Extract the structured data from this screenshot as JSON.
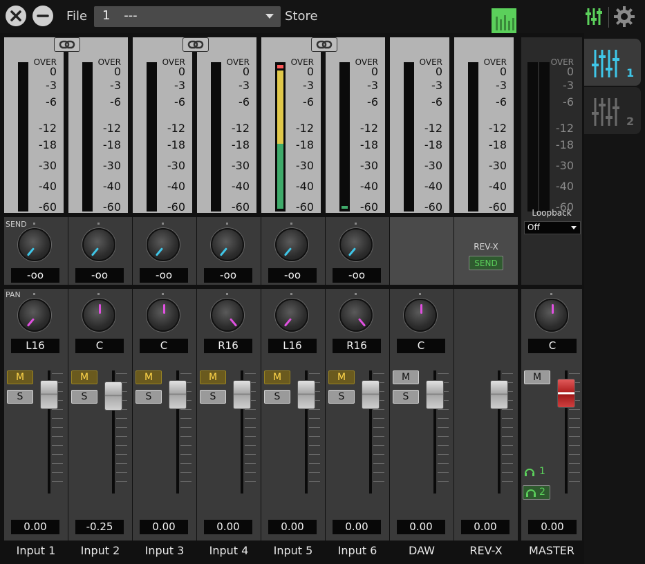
{
  "topbar": {
    "file_label": "File",
    "file_number": "1",
    "file_name": "---",
    "store_label": "Store"
  },
  "colors": {
    "accent_cyan": "#3fc6e8",
    "pan_magenta": "#e050e0",
    "send_green": "#5bd05b",
    "mute_yellow": "#ffd54a",
    "master_red": "#c02a2a"
  },
  "icons": [
    "close-icon",
    "minimize-icon",
    "chevron-down-icon",
    "meter-icon",
    "mixer-icon",
    "gear-icon",
    "link-icon",
    "headphones-icon"
  ],
  "meter_scale": [
    "OVER",
    "0",
    "-3",
    "-6",
    "-12",
    "-18",
    "-30",
    "-40",
    "-60"
  ],
  "section_labels": {
    "send": "SEND",
    "pan": "PAN"
  },
  "strips": [
    {
      "name": "Input 1",
      "send_value": "-oo",
      "pan_value": "L16",
      "fader_value": "0.00",
      "mute_label": "M",
      "solo_label": "S"
    },
    {
      "name": "Input 2",
      "send_value": "-oo",
      "pan_value": "C",
      "fader_value": "-0.25",
      "mute_label": "M",
      "solo_label": "S"
    },
    {
      "name": "Input 3",
      "send_value": "-oo",
      "pan_value": "C",
      "fader_value": "0.00",
      "mute_label": "M",
      "solo_label": "S"
    },
    {
      "name": "Input 4",
      "send_value": "-oo",
      "pan_value": "R16",
      "fader_value": "0.00",
      "mute_label": "M",
      "solo_label": "S"
    },
    {
      "name": "Input 5",
      "send_value": "-oo",
      "pan_value": "L16",
      "fader_value": "0.00",
      "mute_label": "M",
      "solo_label": "S"
    },
    {
      "name": "Input 6",
      "send_value": "-oo",
      "pan_value": "R16",
      "fader_value": "0.00",
      "mute_label": "M",
      "solo_label": "S"
    },
    {
      "name": "DAW",
      "pan_value": "C",
      "fader_value": "0.00",
      "mute_label": "M",
      "solo_label": "S"
    },
    {
      "name": "REV-X",
      "fader_value": "0.00",
      "rev_label": "REV-X",
      "send_button": "SEND"
    }
  ],
  "master": {
    "name": "MASTER",
    "loopback_label": "Loopback",
    "loopback_value": "Off",
    "pan_value": "C",
    "fader_value": "0.00",
    "mute_label": "M",
    "phones_1": "1",
    "phones_2": "2"
  },
  "tabs": [
    {
      "label": "1",
      "selected": true
    },
    {
      "label": "2",
      "selected": false
    }
  ]
}
